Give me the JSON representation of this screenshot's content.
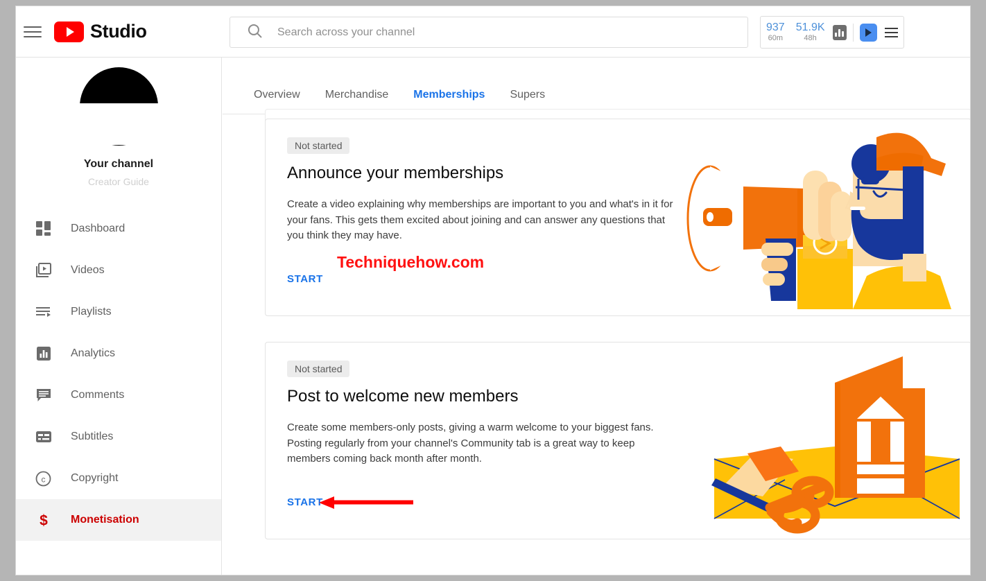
{
  "app": {
    "brand": "Studio",
    "menu_icon": "hamburger-icon",
    "logo_icon": "youtube-logo-icon"
  },
  "search": {
    "placeholder": "Search across your channel",
    "value": "",
    "icon": "search-icon"
  },
  "stats": {
    "items": [
      {
        "value": "937",
        "label": "60m"
      },
      {
        "value": "51.9K",
        "label": "48h"
      }
    ],
    "chart_icon": "bar-chart-icon",
    "app_icon": "video-app-icon",
    "menu_icon": "hamburger-icon",
    "accent_color": "#4d90d9"
  },
  "sidebar": {
    "channel_name": "Your channel",
    "creator_guide": "Creator Guide",
    "avatar_icon": "avatar",
    "items": [
      {
        "label": "Dashboard",
        "icon": "dashboard-icon",
        "active": false
      },
      {
        "label": "Videos",
        "icon": "videos-icon",
        "active": false
      },
      {
        "label": "Playlists",
        "icon": "playlists-icon",
        "active": false
      },
      {
        "label": "Analytics",
        "icon": "analytics-icon",
        "active": false
      },
      {
        "label": "Comments",
        "icon": "comments-icon",
        "active": false
      },
      {
        "label": "Subtitles",
        "icon": "subtitles-icon",
        "active": false
      },
      {
        "label": "Copyright",
        "icon": "copyright-icon",
        "active": false
      },
      {
        "label": "Monetisation",
        "icon": "dollar-icon",
        "active": true
      }
    ],
    "active_color": "#cc0000"
  },
  "main": {
    "tabs": [
      {
        "label": "Overview",
        "active": false
      },
      {
        "label": "Merchandise",
        "active": false
      },
      {
        "label": "Memberships",
        "active": true
      },
      {
        "label": "Supers",
        "active": false
      }
    ],
    "tab_accent": "#1a73e8",
    "cards": [
      {
        "status": "Not started",
        "title": "Announce your memberships",
        "description": "Create a video explaining why memberships are important to you and what's in it for your fans. This gets them excited about joining and can answer any questions that you think they may have.",
        "action": "START",
        "illustration": "megaphone-person-illustration"
      },
      {
        "status": "Not started",
        "title": "Post to welcome new members",
        "description": "Create some members-only posts, giving a warm welcome to your biggest fans. Posting regularly from your channel's Community tab is a great way to keep members coming back month after month.",
        "action": "START",
        "illustration": "greeting-card-scissors-illustration"
      }
    ]
  },
  "annotations": {
    "watermark": "Techniquehow.com",
    "watermark_color": "#ff1111",
    "arrow_color": "#ff0000",
    "arrow_icon": "red-arrow-left-icon"
  }
}
